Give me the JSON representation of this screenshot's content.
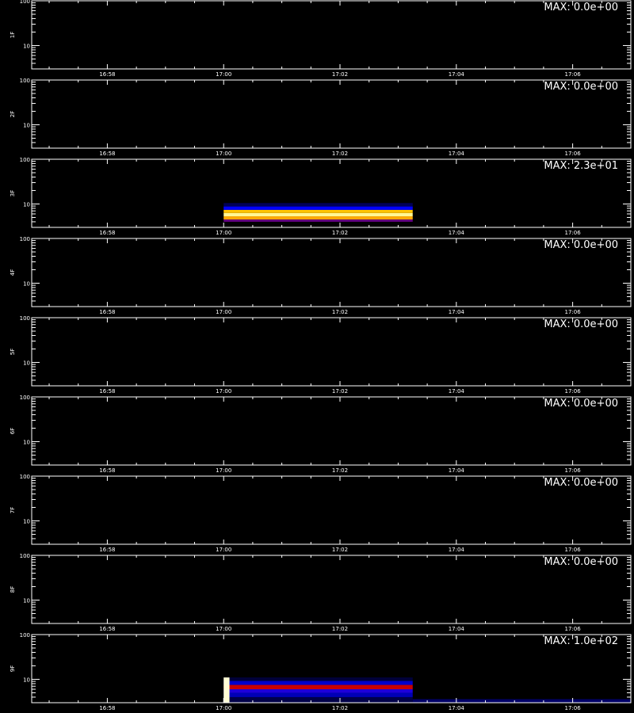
{
  "chart_data": {
    "type": "heatmap",
    "x_ticks": [
      "16:58",
      "17:00",
      "17:02",
      "17:04",
      "17:06"
    ],
    "x_tick_values_min": [
      -2,
      0,
      2,
      4,
      6
    ],
    "x_range_min": [
      -3.3,
      7.0
    ],
    "y_scale": "log",
    "y_ticks": [
      "10",
      "100"
    ],
    "y_range": [
      3,
      100
    ],
    "footer": "",
    "panels": [
      {
        "name": "1F",
        "max_label": "MAX: 0.0e+00",
        "max": 0,
        "features": []
      },
      {
        "name": "2F",
        "max_label": "MAX: 0.0e+00",
        "max": 0,
        "features": []
      },
      {
        "name": "3F",
        "max_label": "MAX: 2.3e+01",
        "max": 23,
        "features": [
          {
            "x0": 0.0,
            "x1": 3.25,
            "y0": 4.0,
            "y1": 4.5,
            "level": 0.45
          },
          {
            "x0": 0.0,
            "x1": 3.25,
            "y0": 4.5,
            "y1": 5.3,
            "level": 0.78
          },
          {
            "x0": 0.0,
            "x1": 3.25,
            "y0": 5.3,
            "y1": 6.3,
            "level": 0.95
          },
          {
            "x0": 0.0,
            "x1": 3.25,
            "y0": 6.3,
            "y1": 7.4,
            "level": 0.82
          },
          {
            "x0": 0.0,
            "x1": 3.25,
            "y0": 7.4,
            "y1": 8.8,
            "level": 0.35
          },
          {
            "x0": 0.0,
            "x1": 3.25,
            "y0": 8.8,
            "y1": 10.5,
            "level": 0.12
          }
        ]
      },
      {
        "name": "4F",
        "max_label": "MAX: 0.0e+00",
        "max": 0,
        "features": []
      },
      {
        "name": "5F",
        "max_label": "MAX: 0.0e+00",
        "max": 0,
        "features": []
      },
      {
        "name": "6F",
        "max_label": "MAX: 0.0e+00",
        "max": 0,
        "features": []
      },
      {
        "name": "7F",
        "max_label": "MAX: 0.0e+00",
        "max": 0,
        "features": []
      },
      {
        "name": "8F",
        "max_label": "MAX: 0.0e+00",
        "max": 0,
        "features": []
      },
      {
        "name": "9F",
        "max_label": "MAX: 1.0e+02",
        "max": 100,
        "features": [
          {
            "x0": 0.0,
            "x1": 3.25,
            "y0": 3.0,
            "y1": 4.0,
            "level": 0.1
          },
          {
            "x0": 0.0,
            "x1": 3.25,
            "y0": 4.0,
            "y1": 5.0,
            "level": 0.25
          },
          {
            "x0": 0.0,
            "x1": 3.25,
            "y0": 5.0,
            "y1": 6.0,
            "level": 0.38
          },
          {
            "x0": 0.0,
            "x1": 3.25,
            "y0": 6.0,
            "y1": 7.5,
            "level": 0.55
          },
          {
            "x0": 0.0,
            "x1": 3.25,
            "y0": 7.5,
            "y1": 9.2,
            "level": 0.28
          },
          {
            "x0": 0.0,
            "x1": 3.25,
            "y0": 9.2,
            "y1": 11.0,
            "level": 0.08
          },
          {
            "x0": 0.0,
            "x1": 0.1,
            "y0": 3.0,
            "y1": 11.0,
            "level": 0.98
          },
          {
            "x0": 3.25,
            "x1": 7.0,
            "y0": 3.0,
            "y1": 3.6,
            "level": 0.14
          }
        ]
      }
    ]
  }
}
